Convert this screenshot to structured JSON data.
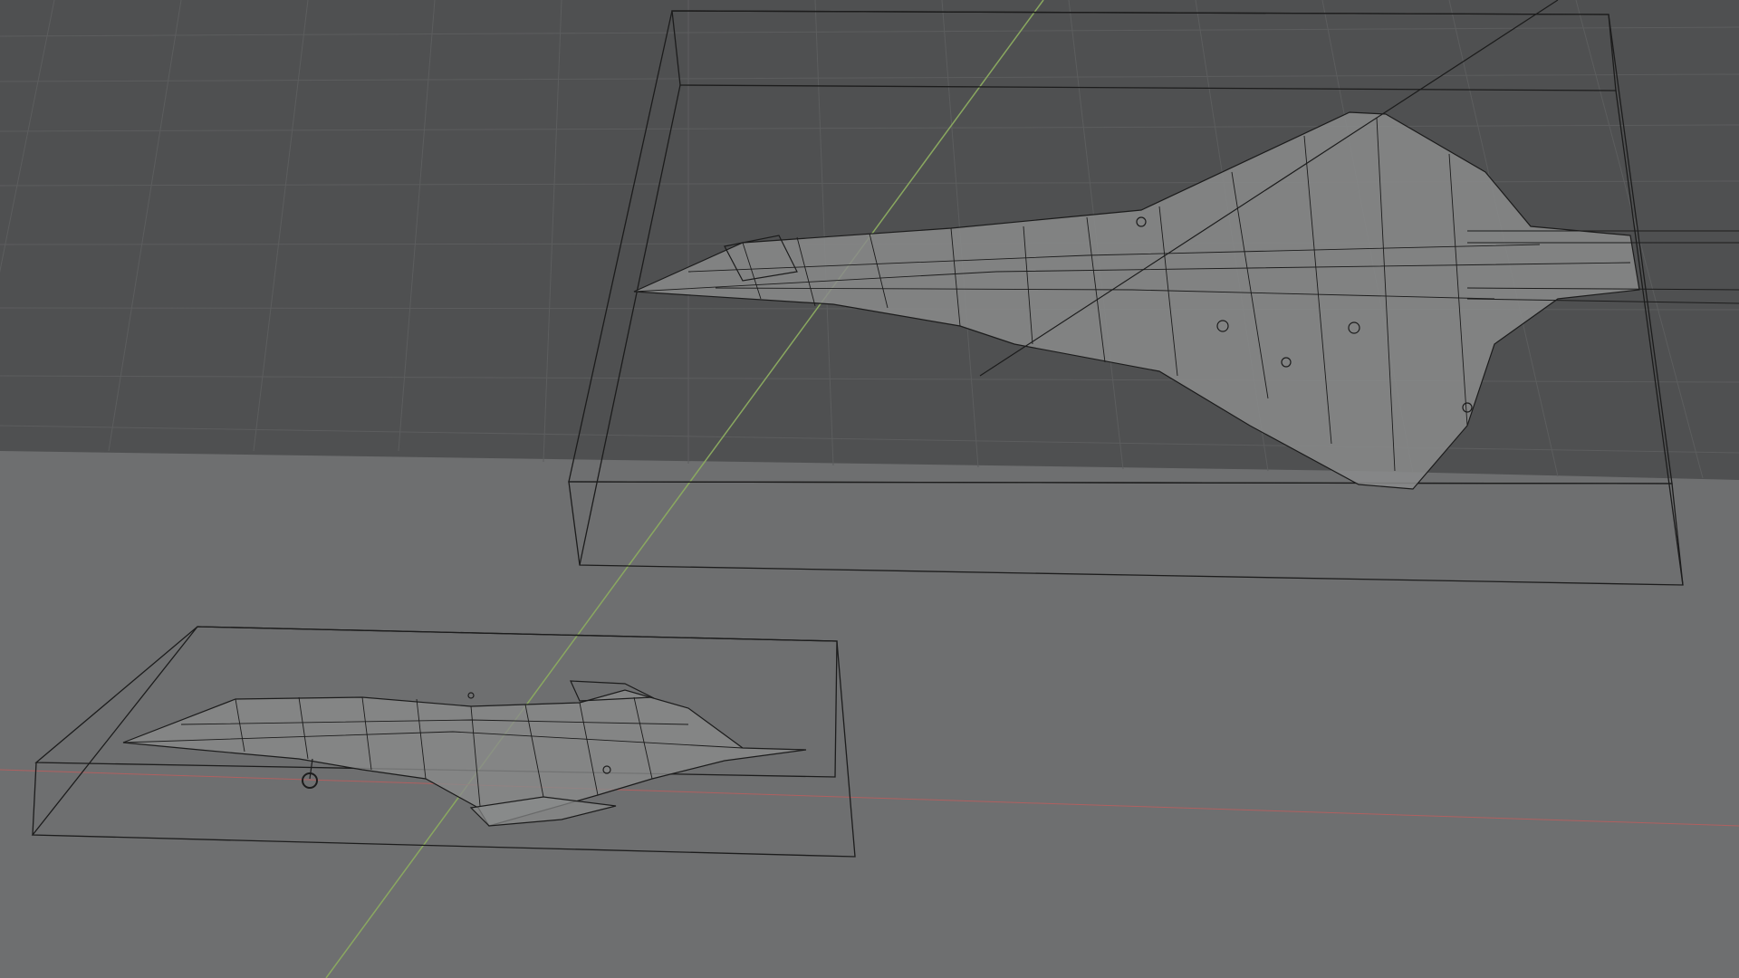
{
  "viewport": {
    "mode": "wireframe",
    "colors": {
      "background": "#6e6f70",
      "grid_plane": "#4f5051",
      "grid_line": "#5d5e5f",
      "y_axis": "#8aa860",
      "x_axis": "#b06060",
      "wire": "#1c1c1c",
      "mesh_fill": "#8a8b8b"
    }
  },
  "objects": [
    {
      "id": "aircraft-large",
      "type": "mesh",
      "bounds": "box"
    },
    {
      "id": "aircraft-small",
      "type": "mesh",
      "bounds": "box"
    }
  ]
}
